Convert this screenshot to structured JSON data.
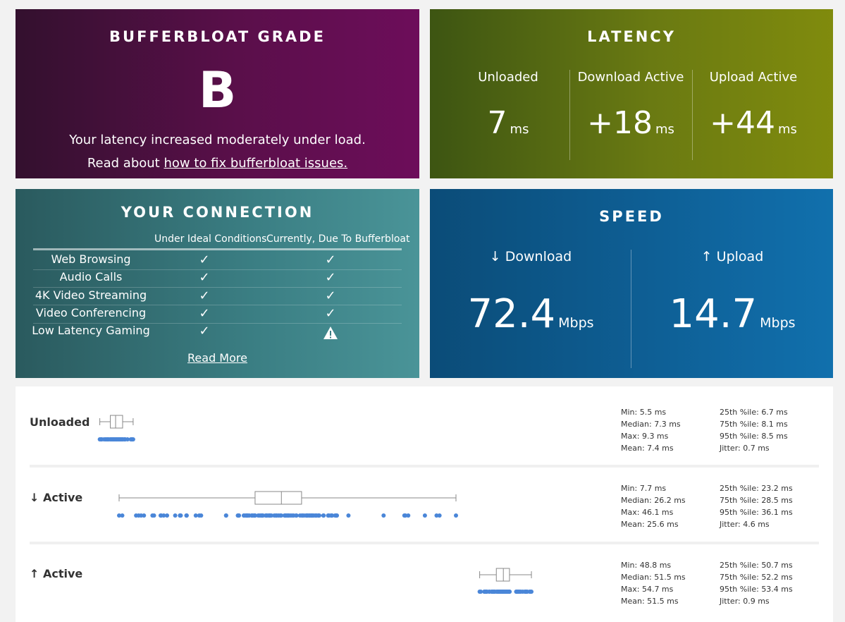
{
  "grade": {
    "title": "BUFFERBLOAT GRADE",
    "letter": "B",
    "message": "Your latency increased moderately under load.",
    "read_prefix": "Read about ",
    "link_text": "how to fix bufferbloat issues."
  },
  "latency": {
    "title": "LATENCY",
    "columns": [
      {
        "label": "Unloaded",
        "value": "7",
        "unit": "ms"
      },
      {
        "label": "Download Active",
        "value": "+18",
        "unit": "ms"
      },
      {
        "label": "Upload Active",
        "value": "+44",
        "unit": "ms"
      }
    ]
  },
  "connection": {
    "title": "YOUR CONNECTION",
    "headers": [
      "Under Ideal Conditions",
      "Currently, Due To Bufferbloat"
    ],
    "rows": [
      {
        "label": "Web Browsing",
        "ideal": "check",
        "current": "check"
      },
      {
        "label": "Audio Calls",
        "ideal": "check",
        "current": "check"
      },
      {
        "label": "4K Video Streaming",
        "ideal": "check",
        "current": "check"
      },
      {
        "label": "Video Conferencing",
        "ideal": "check",
        "current": "check"
      },
      {
        "label": "Low Latency Gaming",
        "ideal": "check",
        "current": "warning"
      }
    ],
    "read_more": "Read More"
  },
  "speed": {
    "title": "SPEED",
    "download": {
      "label": "↓ Download",
      "value": "72.4",
      "unit": "Mbps"
    },
    "upload": {
      "label": "↑ Upload",
      "value": "14.7",
      "unit": "Mbps"
    }
  },
  "distribution": {
    "rows": [
      {
        "label": "Unloaded",
        "box": {
          "min": 5.5,
          "q1": 6.7,
          "median": 7.3,
          "q3": 8.1,
          "max": 9.3
        },
        "stats_left": [
          "Min: 5.5 ms",
          "Median: 7.3 ms",
          "Max: 9.3 ms",
          "Mean: 7.4 ms"
        ],
        "stats_right": [
          "25th %ile: 6.7 ms",
          "75th %ile: 8.1 ms",
          "95th %ile: 8.5 ms",
          "Jitter: 0.7 ms"
        ]
      },
      {
        "label": "↓ Active",
        "box": {
          "min": 7.7,
          "q1": 23.2,
          "median": 26.2,
          "q3": 28.5,
          "max": 46.1
        },
        "stats_left": [
          "Min: 7.7 ms",
          "Median: 26.2 ms",
          "Max: 46.1 ms",
          "Mean: 25.6 ms"
        ],
        "stats_right": [
          "25th %ile: 23.2 ms",
          "75th %ile: 28.5 ms",
          "95th %ile: 36.1 ms",
          "Jitter: 4.6 ms"
        ]
      },
      {
        "label": "↑ Active",
        "box": {
          "min": 48.8,
          "q1": 50.7,
          "median": 51.5,
          "q3": 52.2,
          "max": 54.7
        },
        "stats_left": [
          "Min: 48.8 ms",
          "Median: 51.5 ms",
          "Max: 54.7 ms",
          "Mean: 51.5 ms"
        ],
        "stats_right": [
          "25th %ile: 50.7 ms",
          "75th %ile: 52.2 ms",
          "95th %ile: 53.4 ms",
          "Jitter: 0.9 ms"
        ]
      }
    ],
    "colors": {
      "points": "#4a86d8",
      "box": "#888888"
    }
  }
}
